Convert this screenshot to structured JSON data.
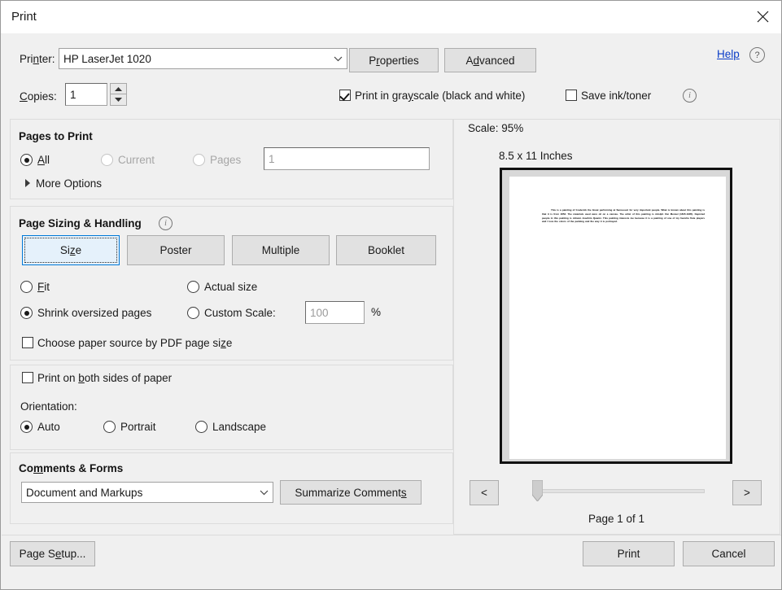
{
  "window": {
    "title": "Print",
    "close_icon": "close-icon"
  },
  "printer": {
    "label": "Printer:",
    "label_pre": "Pri",
    "label_ak": "n",
    "label_post": "ter:",
    "value": "HP LaserJet 1020",
    "dropdown_icon": "chevron-down-icon",
    "properties_button": "Properties",
    "properties_pre": "P",
    "properties_ak": "r",
    "properties_post": "operties",
    "advanced_button": "Advanced",
    "advanced_pre": "A",
    "advanced_ak": "d",
    "advanced_post": "vanced",
    "help_link": "Help",
    "help_icon": "question-circle-icon",
    "copies_label": "Copies:",
    "copies_ak": "C",
    "copies_post": "opies:",
    "copies_value": "1",
    "spinner_up_icon": "triangle-up-icon",
    "spinner_down_icon": "triangle-down-icon",
    "grayscale_label": "Print in grayscale (black and white)",
    "grayscale_pre": "Print in gra",
    "grayscale_ak": "y",
    "grayscale_post": "scale (black and white)",
    "grayscale_checked": true,
    "save_ink_label": "Save ink/toner",
    "save_ink_checked": false,
    "info_icon": "info-circle-icon"
  },
  "pages_to_print": {
    "header": "Pages to Print",
    "options": [
      {
        "label": "All",
        "ak": "A",
        "post": "ll",
        "selected": true,
        "disabled": false
      },
      {
        "label": "Current",
        "selected": false,
        "disabled": true
      },
      {
        "label": "Pages",
        "selected": false,
        "disabled": true
      }
    ],
    "pages_value": "1",
    "more_options": "More Options",
    "more_options_icon": "triangle-right-icon"
  },
  "page_sizing": {
    "header": "Page Sizing & Handling",
    "info_icon": "info-circle-icon",
    "tabs": [
      {
        "label": "Size",
        "pre": "Si",
        "ak": "z",
        "post": "e",
        "active": true
      },
      {
        "label": "Poster",
        "active": false
      },
      {
        "label": "Multiple",
        "active": false
      },
      {
        "label": "Booklet",
        "active": false
      }
    ],
    "fit_label": "Fit",
    "fit_ak": "F",
    "fit_post": "it",
    "fit_selected": false,
    "actual_size_label": "Actual size",
    "actual_size_selected": false,
    "shrink_label": "Shrink oversized pages",
    "shrink_selected": true,
    "custom_scale_label": "Custom Scale:",
    "custom_scale_selected": false,
    "custom_scale_value": "100",
    "percent_sign": "%",
    "paper_source_label": "Choose paper source by PDF page size",
    "paper_source_pre": "Choose paper source by PDF page si",
    "paper_source_ak": "z",
    "paper_source_post": "e",
    "paper_source_checked": false
  },
  "duplex": {
    "both_sides_label": "Print on both sides of paper",
    "both_sides_pre": "Print on ",
    "both_sides_ak": "b",
    "both_sides_post": "oth sides of paper",
    "both_sides_checked": false,
    "orientation_label": "Orientation:",
    "options": [
      {
        "label": "Auto",
        "selected": true
      },
      {
        "label": "Portrait",
        "selected": false
      },
      {
        "label": "Landscape",
        "selected": false
      }
    ]
  },
  "comments_forms": {
    "header": "Comments & Forms",
    "header_pre": "Co",
    "header_ak": "m",
    "header_post": "ments & Forms",
    "value": "Document and Markups",
    "dropdown_icon": "chevron-down-icon",
    "summarize_button": "Summarize Comments",
    "summarize_pre": "Summarize Comment",
    "summarize_ak": "s"
  },
  "preview": {
    "scale_label": "Scale:  95%",
    "paper_size": "8.5 x 11 Inches",
    "document_text": "This is a painting of Frederick the Great performing at Sanssouci for very important people.  What is known about this painting is that it is from 1852.  The materials used were oil on a canvas.  The artist of this painting is Adolph Von Menzel (1815-1905).  Depicted people in this painting is Johann Joachim Quantz.  This painting interests me because it is a painting of one of my favorite flute players and I love the colors of the painting and the way it is portrayed.",
    "prev_button": "<",
    "next_button": ">",
    "page_indicator": "Page 1 of 1"
  },
  "footer": {
    "page_setup_button": "Page Setup...",
    "page_setup_pre": "Page S",
    "page_setup_ak": "e",
    "page_setup_post": "tup...",
    "print_button": "Print",
    "cancel_button": "Cancel"
  },
  "colors": {
    "dialog_bg": "#f0f0f0",
    "accent_blue": "#0078d7",
    "active_tab_bg": "#e5f1fb",
    "link_blue": "#0a3cc7",
    "disabled_text": "#a6a6a6"
  }
}
